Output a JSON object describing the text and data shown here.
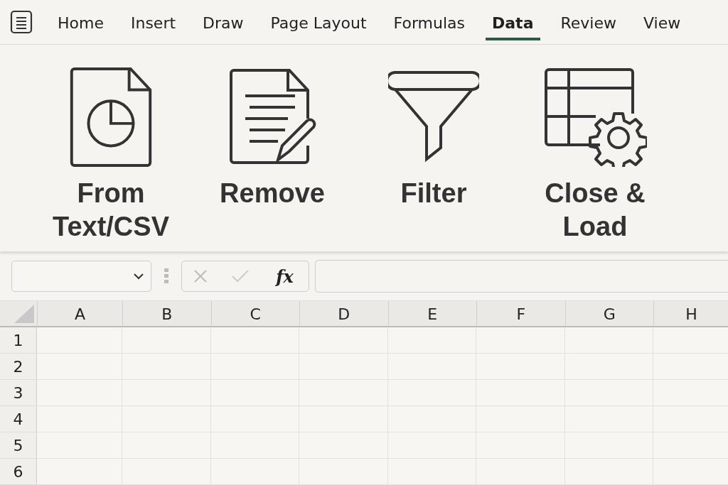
{
  "menu_tabs": [
    {
      "label": "Home",
      "selected": false
    },
    {
      "label": "Insert",
      "selected": false
    },
    {
      "label": "Draw",
      "selected": false
    },
    {
      "label": "Page Layout",
      "selected": false
    },
    {
      "label": "Formulas",
      "selected": false
    },
    {
      "label": "Data",
      "selected": true
    },
    {
      "label": "Review",
      "selected": false
    },
    {
      "label": "View",
      "selected": false
    }
  ],
  "ribbon_buttons": [
    {
      "kind": "text-file",
      "label": "From Text/CSV"
    },
    {
      "kind": "edit-document",
      "label": "Remove"
    },
    {
      "kind": "filter",
      "label": "Filter"
    },
    {
      "kind": "table-settings",
      "label": "Close & Load"
    }
  ],
  "formula_bar": {
    "function_button": "fx"
  },
  "sheet": {
    "columns": [
      "A",
      "B",
      "C",
      "D",
      "E",
      "F",
      "G",
      "H"
    ],
    "rows": [
      "1",
      "2",
      "3",
      "4",
      "5",
      "6"
    ]
  }
}
